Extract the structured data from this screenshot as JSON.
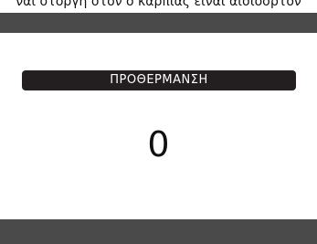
{
  "caption": "ναι στοργή στον ο καρπίας είναι αισιοσρτόν",
  "status": {
    "label": "ΠΡΟΘΕΡΜΑΝΣΗ"
  },
  "display": {
    "value": "0"
  },
  "colors": {
    "bar": "#4a4a4a",
    "pill": "#231f20",
    "background": "#ffffff",
    "text": "#111111"
  }
}
